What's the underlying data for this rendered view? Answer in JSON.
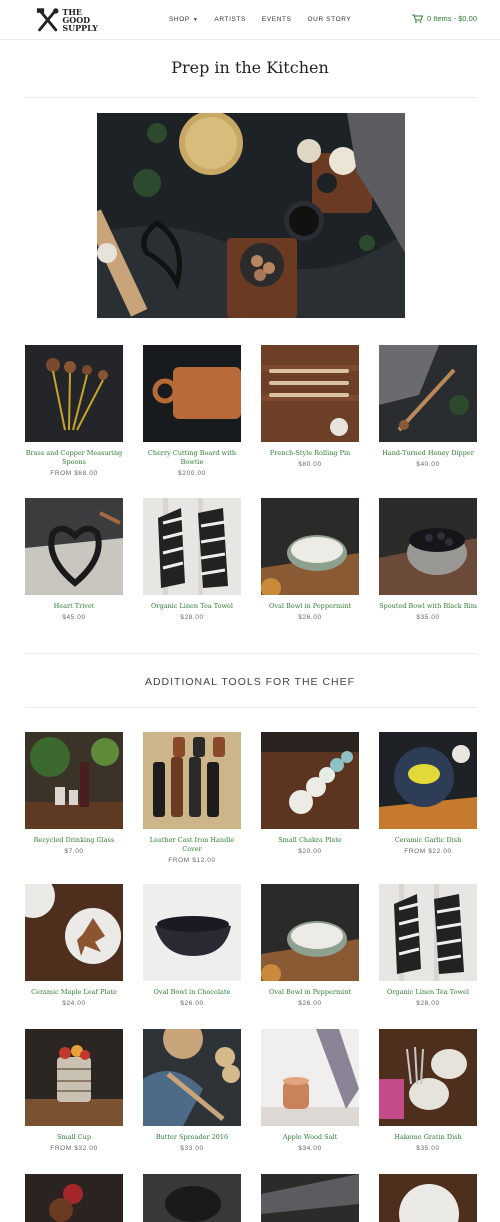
{
  "header": {
    "logo_line1": "THE",
    "logo_line2": "GOOD",
    "logo_line3": "SUPPLY",
    "nav": [
      "SHOP",
      "ARTISTS",
      "EVENTS",
      "OUR STORY"
    ],
    "cart_label": "0 Items - $0.00"
  },
  "page_title": "Prep in the Kitchen",
  "section_heading": "ADDITIONAL TOOLS FOR THE CHEF",
  "products": [
    {
      "name": "Brass and Copper Measuring Spoons",
      "price": "FROM $68.00"
    },
    {
      "name": "Cherry Cutting Board with Bowtie",
      "price": "$200.00"
    },
    {
      "name": "French-Style Rolling Pin",
      "price": "$80.00"
    },
    {
      "name": "Hand-Turned Honey Dipper",
      "price": "$40.00"
    },
    {
      "name": "Heart Trivet",
      "price": "$45.00"
    },
    {
      "name": "Organic Linen Tea Towel",
      "price": "$28.00"
    },
    {
      "name": "Oval Bowl in Peppermint",
      "price": "$26.00"
    },
    {
      "name": "Spouted Bowl with Black Rim",
      "price": "$35.00"
    }
  ],
  "additional": [
    {
      "name": "Recycled Drinking Glass",
      "price": "$7.00"
    },
    {
      "name": "Leather Cast Iron Handle Cover",
      "price": "FROM $12.00"
    },
    {
      "name": "Small Chakra Plate",
      "price": "$20.00"
    },
    {
      "name": "Ceramic Garlic Dish",
      "price": "FROM $22.00"
    },
    {
      "name": "Ceramic Maple Leaf Plate",
      "price": "$24.00"
    },
    {
      "name": "Oval Bowl in Chocolate",
      "price": "$26.00"
    },
    {
      "name": "Oval Bowl in Peppermint",
      "price": "$26.00"
    },
    {
      "name": "Organic Linen Tea Towel",
      "price": "$28.00"
    },
    {
      "name": "Small Cup",
      "price": "FROM $32.00"
    },
    {
      "name": "Butter Spreader 2016",
      "price": "$33.00"
    },
    {
      "name": "Apple Wood Salt",
      "price": "$34.00"
    },
    {
      "name": "Hakeme Gratin Dish",
      "price": "$35.00"
    }
  ],
  "colors": {
    "link": "#2e7d32",
    "rule": "#ececec"
  },
  "icons": [
    "tools-logo-icon",
    "cart-icon",
    "caret-down-icon"
  ]
}
